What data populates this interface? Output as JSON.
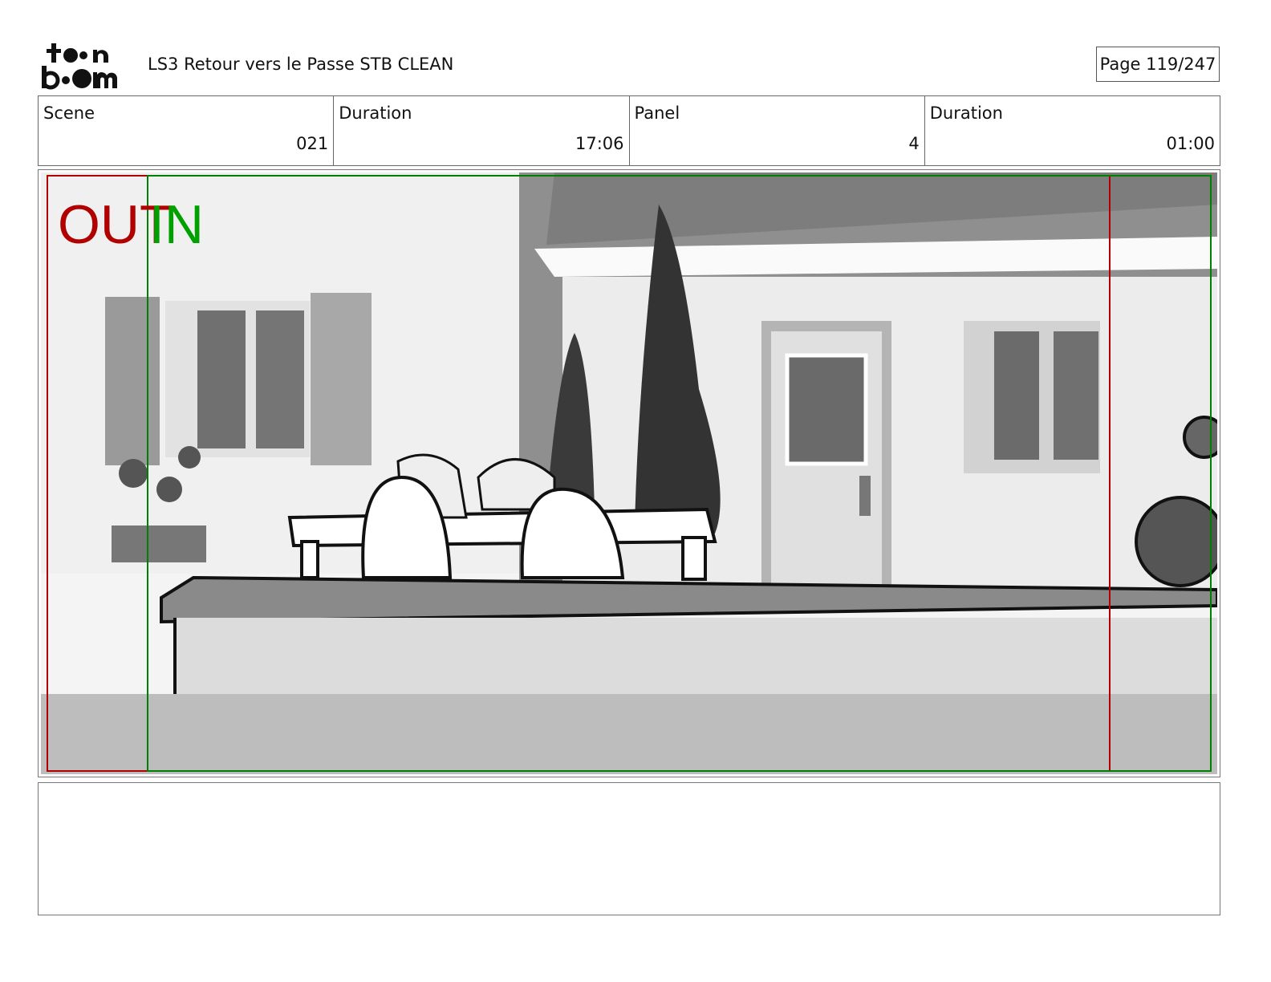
{
  "header": {
    "logo_text": "toon boom",
    "project_title": "LS3 Retour vers le Passe STB CLEAN",
    "page_label": "Page 119/247"
  },
  "info": [
    {
      "label": "Scene",
      "value": "021"
    },
    {
      "label": "Duration",
      "value": "17:06"
    },
    {
      "label": "Panel",
      "value": "4"
    },
    {
      "label": "Duration",
      "value": "01:00"
    }
  ],
  "panel": {
    "out_label": "OUT",
    "in_label": "IN",
    "out_color": "#b00000",
    "in_color": "#00a000"
  },
  "notes": {
    "text": ""
  }
}
